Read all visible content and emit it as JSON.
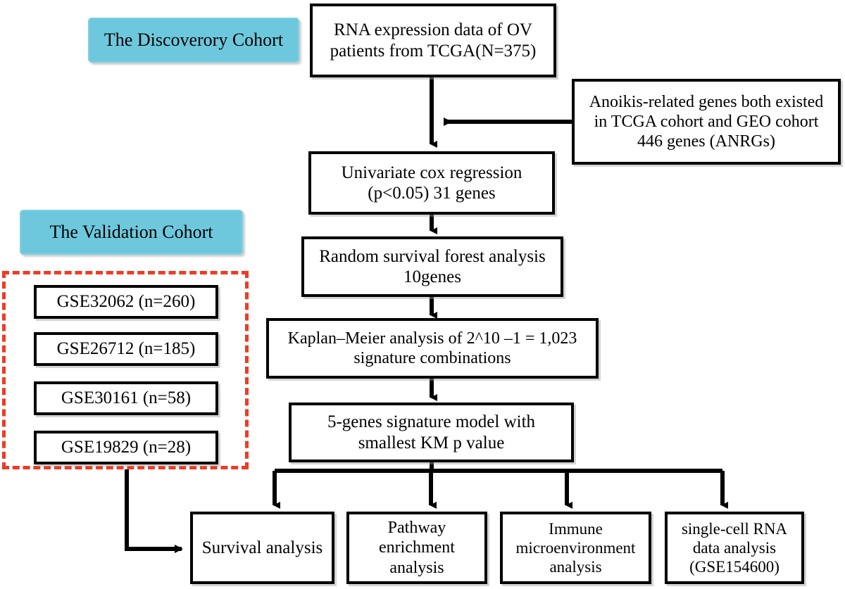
{
  "diagram": {
    "title": "Study workflow flowchart",
    "colors": {
      "cohort_label_fill": "#6ec8dd",
      "validation_group_border": "#ef3b24",
      "box_border": "#000000",
      "background": "#ffffff"
    }
  },
  "labels": {
    "discovery_cohort": "The Discoverory Cohort",
    "validation_cohort": "The Validation Cohort"
  },
  "nodes": {
    "rna_source": "RNA expression data of OV\npatients from TCGA(N=375)",
    "anrgs": "Anoikis-related genes both existed\nin TCGA cohort and GEO cohort\n446 genes (ANRGs)",
    "univariate_cox": "Univariate cox regression\n(p<0.05)  31 genes",
    "random_forest": "Random survival forest analysis\n10genes",
    "kaplan_meier": "Kaplan–Meier analysis of 2^10 –1 = 1,023\nsignature combinations",
    "signature_model": "5-genes signature model with\nsmallest KM p value"
  },
  "validation_datasets": [
    {
      "label": "GSE32062 (n=260)"
    },
    {
      "label": "GSE26712 (n=185)"
    },
    {
      "label": "GSE30161 (n=58)"
    },
    {
      "label": "GSE19829 (n=28)"
    }
  ],
  "downstream_analyses": [
    {
      "label": "Survival analysis"
    },
    {
      "label": "Pathway\nenrichment\nanalysis"
    },
    {
      "label": "Immune\nmicroenvironment\nanalysis"
    },
    {
      "label": "single-cell RNA\ndata analysis\n(GSE154600)"
    }
  ]
}
